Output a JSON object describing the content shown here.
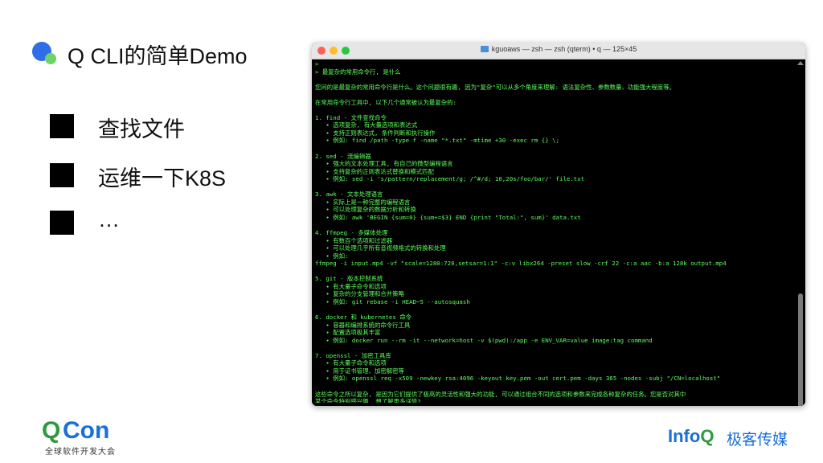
{
  "slide": {
    "title": "Q CLI的简单Demo",
    "bullets": [
      "查找文件",
      "运维一下K8S",
      "…"
    ]
  },
  "terminal": {
    "window_title": "kguoaws — zsh — zsh (qterm) • q — 125×45",
    "lines": [
      "> ",
      "> 最复杂的常用命令行, 是什么",
      "",
      "您问的是最复杂的常用命令行是什么。这个问题很有趣, 因为\"复杂\"可以从多个角度来理解: 语法复杂性、参数数量、功能强大程度等。",
      "",
      "在常用命令行工具中, 以下几个通常被认为最复杂的:",
      "",
      "1. find - 文件查找命令",
      "   • 选项复杂, 有大量选项和表达式",
      "   • 支持正则表达式, 条件判断和执行操作",
      "   • 例如: find /path -type f -name \"*.txt\" -mtime +30 -exec rm {} \\;",
      "",
      "2. sed - 流编辑器",
      "   • 强大的文本处理工具, 有自己的微型编程语言",
      "   • 支持复杂的正则表达式替换和模式匹配",
      "   • 例如: sed -i 's/pattern/replacement/g; /^#/d; 10,20s/foo/bar/' file.txt",
      "",
      "3. awk - 文本处理语言",
      "   • 实际上是一种完整的编程语言",
      "   • 可以处理复杂的数据分析和转换",
      "   • 例如: awk 'BEGIN {sum=0} {sum+=$3} END {print \"Total:\", sum}' data.txt",
      "",
      "4. ffmpeg - 多媒体处理",
      "   • 有数百个选项和过滤器",
      "   • 可以处理几乎所有音视频格式的转换和处理",
      "   • 例如:",
      "ffmpeg -i input.mp4 -vf \"scale=1280:720,setsar=1:1\" -c:v libx264 -preset slow -crf 22 -c:a aac -b:a 128k output.mp4",
      "",
      "5. git - 版本控制系统",
      "   • 有大量子命令和选项",
      "   • 复杂的分支管理和合并策略",
      "   • 例如: git rebase -i HEAD~5 --autosquash",
      "",
      "6. docker 和 kubernetes 命令",
      "   • 容器和编排系统的命令行工具",
      "   • 配置选项极其丰富",
      "   • 例如: docker run --rm -it --network=host -v $(pwd):/app -e ENV_VAR=value image:tag command",
      "",
      "7. openssl - 加密工具库",
      "   • 有大量子命令和选项",
      "   • 用于证书管理、加密解密等",
      "   • 例如: openssl req -x509 -newkey rsa:4096 -keyout key.pem -out cert.pem -days 365 -nodes -subj \"/CN=localhost\"",
      "",
      "这些命令之所以复杂, 是因为它们提供了极高的灵活性和强大的功能, 可以通过组合不同的选项和参数来完成各种复杂的任务。您是否对其中",
      "某个命令特别感兴趣, 想了解更多详情?"
    ]
  },
  "footer": {
    "qcon_q": "Q",
    "qcon_rest": "Con",
    "qcon_sub": "全球软件开发大会",
    "infoq_info": "Info",
    "infoq_q": "Q",
    "brand_cn": "极客传媒"
  },
  "colors": {
    "terminal_text": "#5dff5d",
    "accent_blue": "#1a6fd8",
    "accent_green": "#2d9a3e"
  }
}
